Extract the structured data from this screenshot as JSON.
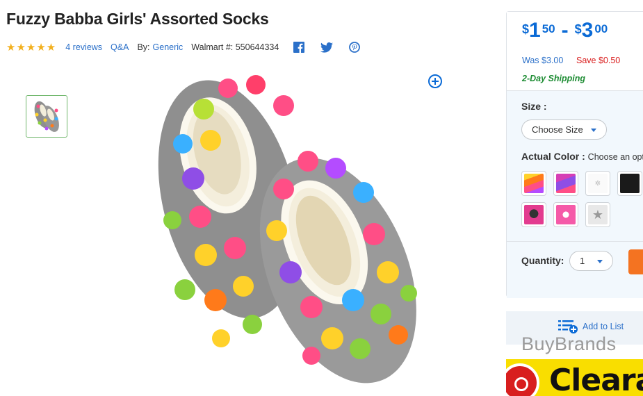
{
  "product": {
    "title": "Fuzzy Babba Girls' Assorted Socks",
    "stars": "★★★★★",
    "reviews": "4 reviews",
    "qa": "Q&A",
    "by_label": "By:",
    "brand": "Generic",
    "walmart_no": "Walmart #: 550644334"
  },
  "social": {
    "icons": [
      "facebook-icon",
      "twitter-icon",
      "pinterest-icon"
    ]
  },
  "price": {
    "currency": "$",
    "low_whole": "1",
    "low_cents": "50",
    "dash": "-",
    "high_whole": "3",
    "high_cents": "00",
    "was": "Was $3.00",
    "save": "Save $0.50",
    "shipping": "2-Day Shipping"
  },
  "options": {
    "size_label": "Size :",
    "size_value": "Choose Size",
    "color_label": "Actual Color :",
    "color_hint": "Choose an opt",
    "quantity_label": "Quantity:",
    "quantity_value": "1"
  },
  "list": {
    "add_to_list": "Add to List"
  },
  "watermark": "BuyBrands",
  "banner": {
    "text": "Clearanc"
  },
  "colors": {
    "accent_blue": "#0a6ad6",
    "link_blue": "#2b70c9",
    "shipping_green": "#1d8c33",
    "save_red": "#d91c1c",
    "cart_orange": "#f47321",
    "star_gold": "#f2b01e"
  }
}
